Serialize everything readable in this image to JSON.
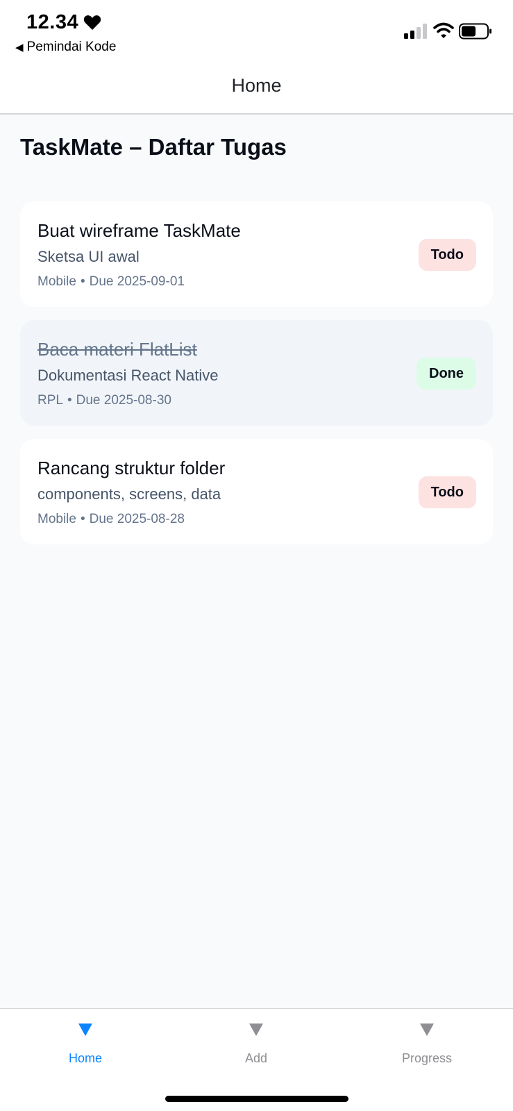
{
  "status_bar": {
    "time": "12.34",
    "back_app": "Pemindai Kode",
    "icons": [
      "heart-icon",
      "signal-icon",
      "wifi-icon",
      "battery-icon"
    ]
  },
  "nav": {
    "title": "Home"
  },
  "page": {
    "title": "TaskMate – Daftar Tugas"
  },
  "tasks": [
    {
      "title": "Buat wireframe TaskMate",
      "description": "Sketsa UI awal",
      "category": "Mobile",
      "due": "Due 2025-09-01",
      "status": "Todo"
    },
    {
      "title": "Baca materi FlatList",
      "description": "Dokumentasi React Native",
      "category": "RPL",
      "due": "Due 2025-08-30",
      "status": "Done"
    },
    {
      "title": "Rancang struktur folder",
      "description": "components, screens, data",
      "category": "Mobile",
      "due": "Due 2025-08-28",
      "status": "Todo"
    }
  ],
  "meta_separator": "•",
  "tab_bar": {
    "items": [
      {
        "label": "Home",
        "active": true
      },
      {
        "label": "Add",
        "active": false
      },
      {
        "label": "Progress",
        "active": false
      }
    ]
  },
  "colors": {
    "accent": "#0a84ff",
    "todo_badge": "#fde2e2",
    "done_badge": "#dcfce7",
    "inactive_tab": "#8e8e93"
  }
}
